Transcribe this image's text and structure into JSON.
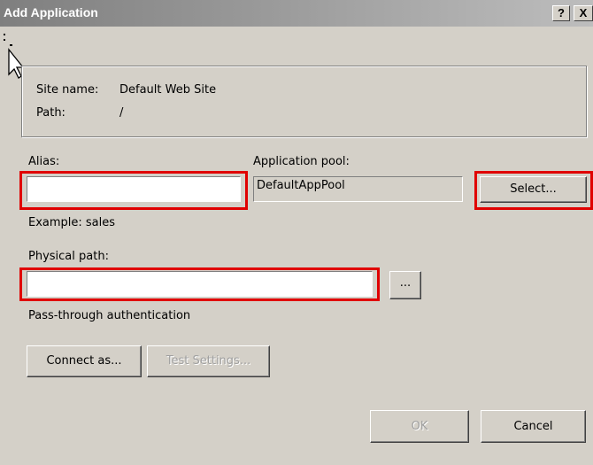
{
  "window": {
    "title": "Add Application",
    "help_label": "?",
    "close_label": "X"
  },
  "info": {
    "site_label": "Site name:",
    "site_value": "Default Web Site",
    "path_label": "Path:",
    "path_value": "/"
  },
  "alias": {
    "label": "Alias:",
    "value": "",
    "example": "Example: sales"
  },
  "app_pool": {
    "label": "Application pool:",
    "value": "DefaultAppPool",
    "select_label": "Select..."
  },
  "physical_path": {
    "label": "Physical path:",
    "value": "",
    "browse_label": "..."
  },
  "auth": {
    "label": "Pass-through authentication",
    "connect_label": "Connect as...",
    "test_label": "Test Settings..."
  },
  "footer": {
    "ok_label": "OK",
    "cancel_label": "Cancel"
  },
  "colors": {
    "highlight": "#e00000",
    "dialog_bg": "#d4d0c8"
  }
}
